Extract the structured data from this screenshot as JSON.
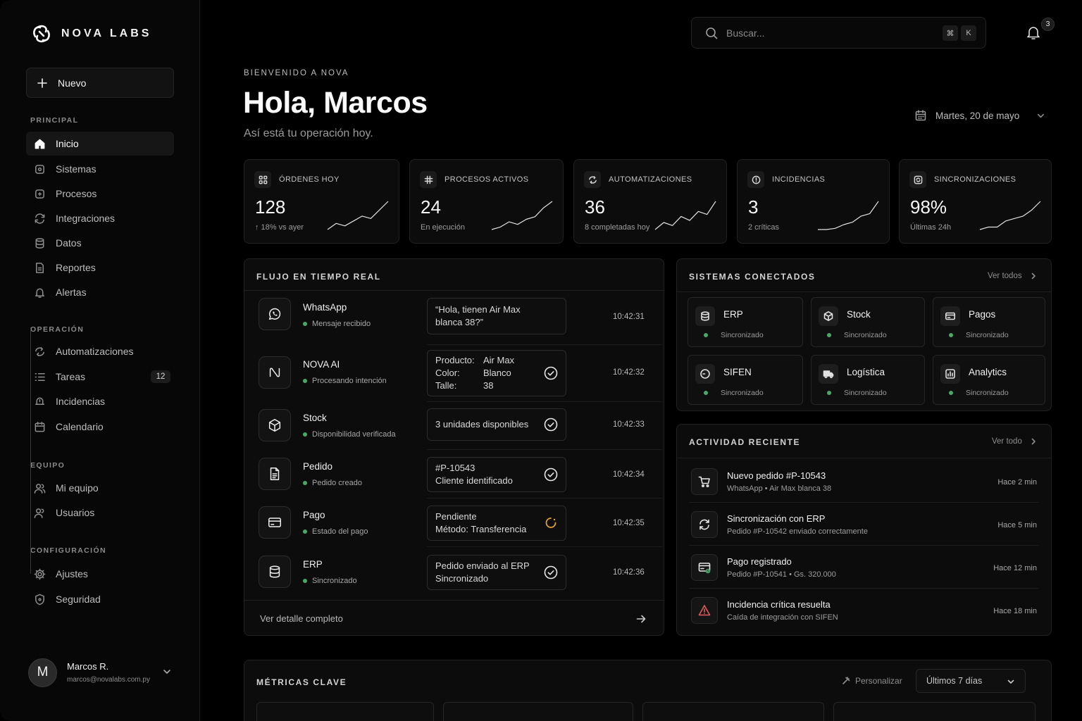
{
  "brand": {
    "name": "NOVA LABS"
  },
  "sidebar": {
    "new_button": "Nuevo",
    "sections": [
      {
        "title": "PRINCIPAL",
        "items": [
          {
            "label": "Inicio",
            "icon": "home-icon",
            "active": true
          },
          {
            "label": "Sistemas",
            "icon": "cpu-icon"
          },
          {
            "label": "Procesos",
            "icon": "process-icon"
          },
          {
            "label": "Integraciones",
            "icon": "sync-icon"
          },
          {
            "label": "Datos",
            "icon": "database-icon"
          },
          {
            "label": "Reportes",
            "icon": "report-icon"
          },
          {
            "label": "Alertas",
            "icon": "bell-icon"
          }
        ]
      },
      {
        "title": "OPERACIÓN",
        "items": [
          {
            "label": "Automatizaciones",
            "icon": "automation-icon"
          },
          {
            "label": "Tareas",
            "icon": "list-icon",
            "badge": "12"
          },
          {
            "label": "Incidencias",
            "icon": "incident-icon"
          },
          {
            "label": "Calendario",
            "icon": "calendar-icon"
          }
        ]
      },
      {
        "title": "EQUIPO",
        "items": [
          {
            "label": "Mi equipo",
            "icon": "team-icon"
          },
          {
            "label": "Usuarios",
            "icon": "users-icon"
          }
        ]
      },
      {
        "title": "CONFIGURACIÓN",
        "items": [
          {
            "label": "Ajustes",
            "icon": "gear-icon"
          },
          {
            "label": "Seguridad",
            "icon": "shield-icon"
          }
        ]
      }
    ],
    "user": {
      "initial": "M",
      "name": "Marcos R.",
      "email": "marcos@novalabs.com.py"
    }
  },
  "topbar": {
    "search_placeholder": "Buscar...",
    "shortcut": [
      "⌘",
      "K"
    ],
    "notifications": "3"
  },
  "header": {
    "eyebrow": "BIENVENIDO A NOVA",
    "greeting": "Hola, Marcos",
    "subtitle": "Así está tu operación hoy.",
    "date": "Martes, 20 de mayo"
  },
  "stats": [
    {
      "label": "ÓRDENES HOY",
      "value": "128",
      "note": "↑ 18% vs ayer",
      "icon": "grid-icon",
      "trend": [
        3,
        8,
        6,
        10,
        14,
        12,
        19,
        26
      ]
    },
    {
      "label": "PROCESOS ACTIVOS",
      "value": "24",
      "note": "En ejecución",
      "icon": "hash-icon",
      "trend": [
        3,
        5,
        9,
        7,
        11,
        13,
        20,
        25
      ]
    },
    {
      "label": "AUTOMATIZACIONES",
      "value": "36",
      "note": "8 completadas hoy",
      "icon": "automation-icon",
      "trend": [
        2,
        9,
        6,
        15,
        11,
        20,
        17,
        30
      ]
    },
    {
      "label": "INCIDENCIAS",
      "value": "3",
      "note": "2 críticas",
      "icon": "alert-circle-icon",
      "trend": [
        3,
        3,
        4,
        7,
        9,
        14,
        16,
        26
      ]
    },
    {
      "label": "SINCRONIZACIONES",
      "value": "98%",
      "note": "Últimas 24h",
      "icon": "sync-square-icon",
      "trend": [
        2,
        4,
        4,
        9,
        11,
        13,
        18,
        25
      ]
    }
  ],
  "flow": {
    "title": "FLUJO EN TIEMPO REAL",
    "rows": [
      {
        "name": "WhatsApp",
        "status": "Mensaje recibido",
        "box": [
          "“Hola, tienen Air Max",
          "blanca 38?”"
        ],
        "check": "none",
        "time": "10:42:31",
        "icon": "whatsapp-icon"
      },
      {
        "name": "NOVA AI",
        "status": "Procesando intención",
        "kv": [
          [
            "Producto:",
            "Air Max"
          ],
          [
            "Color:",
            "Blanco"
          ],
          [
            "Talle:",
            "38"
          ]
        ],
        "check": "done",
        "time": "10:42:32",
        "icon": "nova-ai-icon"
      },
      {
        "name": "Stock",
        "status": "Disponibilidad verificada",
        "box": [
          "3 unidades disponibles"
        ],
        "check": "done",
        "time": "10:42:33",
        "icon": "cube-icon"
      },
      {
        "name": "Pedido",
        "status": "Pedido creado",
        "box": [
          "#P-10543",
          "Cliente identificado"
        ],
        "check": "done",
        "time": "10:42:34",
        "icon": "document-icon"
      },
      {
        "name": "Pago",
        "status": "Estado del pago",
        "box": [
          "Pendiente",
          "Método: Transferencia"
        ],
        "check": "pending",
        "time": "10:42:35",
        "icon": "card-icon"
      },
      {
        "name": "ERP",
        "status": "Sincronizado",
        "box": [
          "Pedido enviado al ERP",
          "Sincronizado"
        ],
        "check": "done",
        "time": "10:42:36",
        "icon": "database-icon"
      }
    ],
    "footer": "Ver detalle completo"
  },
  "systems": {
    "title": "SISTEMAS CONECTADOS",
    "more": "Ver todos",
    "items": [
      {
        "name": "ERP",
        "state": "Sincronizado",
        "icon": "database-icon"
      },
      {
        "name": "Stock",
        "state": "Sincronizado",
        "icon": "cube-icon"
      },
      {
        "name": "Pagos",
        "state": "Sincronizado",
        "icon": "card-icon"
      },
      {
        "name": "SIFEN",
        "state": "Sincronizado",
        "icon": "sifen-icon"
      },
      {
        "name": "Logística",
        "state": "Sincronizado",
        "icon": "truck-icon"
      },
      {
        "name": "Analytics",
        "state": "Sincronizado",
        "icon": "bar-chart-icon"
      }
    ]
  },
  "activity": {
    "title": "ACTIVIDAD RECIENTE",
    "more": "Ver todo",
    "items": [
      {
        "title": "Nuevo pedido #P-10543",
        "sub": "WhatsApp  •  Air Max blanca 38",
        "time": "Hace 2 min",
        "icon": "cart-icon"
      },
      {
        "title": "Sincronización con ERP",
        "sub": "Pedido #P-10542 enviado correctamente",
        "time": "Hace 5 min",
        "icon": "refresh-icon"
      },
      {
        "title": "Pago registrado",
        "sub": "Pedido #P-10541  •  Gs. 320.000",
        "time": "Hace 12 min",
        "icon": "card-check-icon"
      },
      {
        "title": "Incidencia crítica resuelta",
        "sub": "Caída de integración con SIFEN",
        "time": "Hace 18 min",
        "icon": "warning-icon"
      }
    ]
  },
  "metrics": {
    "title": "MÉTRICAS CLAVE",
    "customize": "Personalizar",
    "range": "Últimos 7 días"
  },
  "colors": {
    "accent_ok": "#4aa86a",
    "pending": "#e0a030",
    "warning": "#e05a5a"
  }
}
